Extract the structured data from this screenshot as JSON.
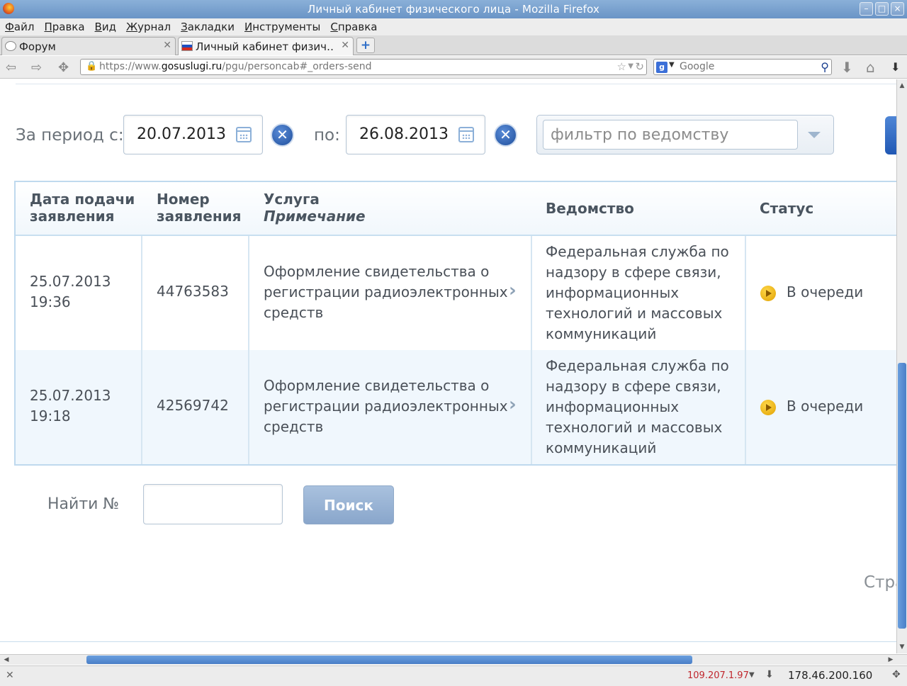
{
  "window": {
    "title": "Личный кабинет физического лица - Mozilla Firefox"
  },
  "menu": [
    "Файл",
    "Правка",
    "Вид",
    "Журнал",
    "Закладки",
    "Инструменты",
    "Справка"
  ],
  "tabs": [
    {
      "label": "Форум"
    },
    {
      "label": "Личный кабинет физич…"
    }
  ],
  "address": {
    "prefix": "https://www.",
    "host": "gosuslugi.ru",
    "path": "/pgu/personcab#_orders-send"
  },
  "search": {
    "placeholder": "Google"
  },
  "filters": {
    "period_from_label": "За период с:",
    "date_from": "20.07.2013",
    "period_to_label": "по:",
    "date_to": "26.08.2013",
    "agency_placeholder": "фильтр по ведомству"
  },
  "table": {
    "headers": {
      "date": [
        "Дата подачи",
        "заявления"
      ],
      "number": [
        "Номер",
        "заявления"
      ],
      "service": "Услуга",
      "note": "Примечание",
      "agency": "Ведомство",
      "status": "Статус"
    },
    "rows": [
      {
        "date": "25.07.2013",
        "time": "19:36",
        "number": "44763583",
        "service": [
          "Оформление свидетельства о",
          "регистрации радиоэлектронных",
          "средств"
        ],
        "agency": [
          "Федеральная служба по",
          "надзору в сфере связи,",
          "информационных",
          "технологий и массовых",
          "коммуникаций"
        ],
        "status": "В очереди"
      },
      {
        "date": "25.07.2013",
        "time": "19:18",
        "number": "42569742",
        "service": [
          "Оформление свидетельства о",
          "регистрации радиоэлектронных",
          "средств"
        ],
        "agency": [
          "Федеральная служба по",
          "надзору в сфере связи,",
          "информационных",
          "технологий и массовых",
          "коммуникаций"
        ],
        "status": "В очереди"
      }
    ]
  },
  "find": {
    "label": "Найти №",
    "button": "Поиск"
  },
  "pagination_cut": "Стра",
  "statusbar": {
    "ip_left": "109.207.1.97",
    "ip_right": "178.46.200.160"
  },
  "colors": {
    "accent": "#2058b4",
    "table_border": "#bfd9ee",
    "status_icon": "#f0b400"
  }
}
